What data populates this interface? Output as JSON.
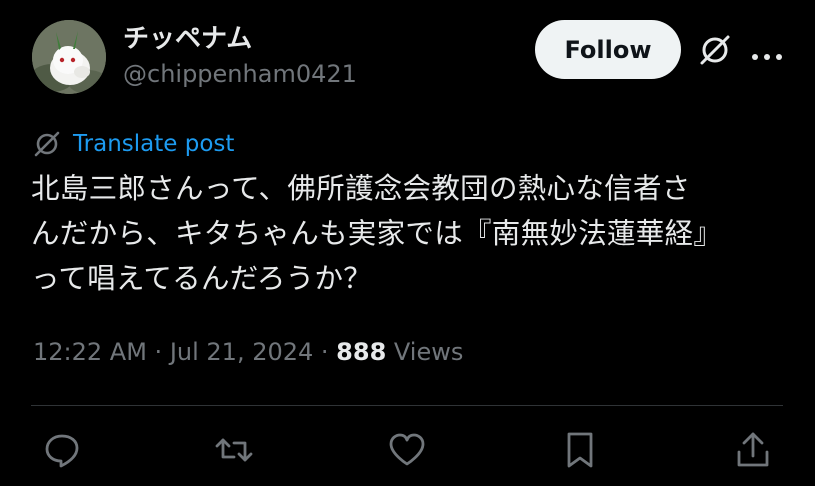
{
  "author": {
    "display_name": "チッペナム",
    "handle": "@chippenham0421",
    "avatar_icon": "white-bunny-avatar"
  },
  "header": {
    "follow_label": "Follow",
    "grok_icon": "grok-icon",
    "more_icon": "more-icon"
  },
  "translate": {
    "label": "Translate post",
    "icon": "translate-icon"
  },
  "post": {
    "text": "北島三郎さんって、佛所護念会教団の熱心な信者さ\nんだから、キタちゃんも実家では『南無妙法蓮華経』\nって唱えてるんだろうか？"
  },
  "meta": {
    "time": "12:22 AM",
    "separator1": " · ",
    "date": "Jul 21, 2024",
    "separator2": " · ",
    "views_count": "888",
    "views_label": " Views"
  },
  "actions": [
    {
      "name": "reply",
      "icon": "reply-icon"
    },
    {
      "name": "repost",
      "icon": "repost-icon"
    },
    {
      "name": "like",
      "icon": "heart-icon"
    },
    {
      "name": "bookmark",
      "icon": "bookmark-icon"
    },
    {
      "name": "share",
      "icon": "share-icon"
    }
  ],
  "colors": {
    "background": "#000000",
    "text_primary": "#e7e9ea",
    "text_secondary": "#71767b",
    "link": "#1d9bf0",
    "button_bg": "#eff3f4",
    "divider": "#2f3336"
  }
}
